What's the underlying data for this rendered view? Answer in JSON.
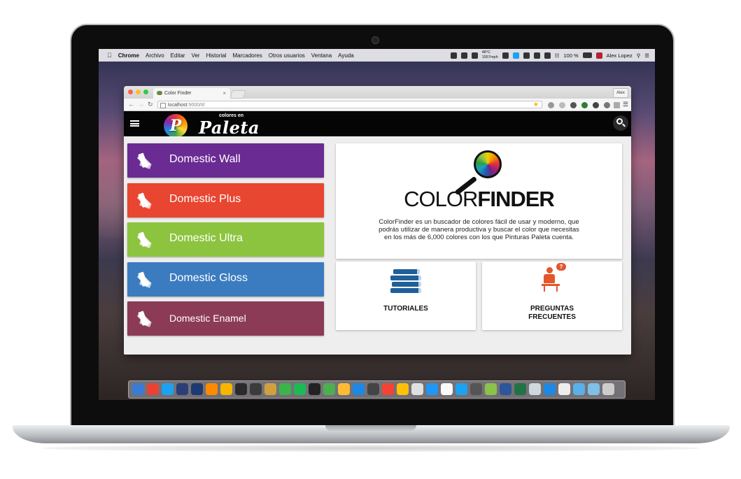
{
  "menubar": {
    "app": "Chrome",
    "items": [
      "Archivo",
      "Editar",
      "Ver",
      "Historial",
      "Marcadores",
      "Otros usuarios",
      "Ventana",
      "Ayuda"
    ],
    "weather_temp": "48°C",
    "weather_time": "1557mph",
    "battery": "100 %",
    "user": "Alex Lopez"
  },
  "browser": {
    "tab_title": "Color Finder",
    "profile": "Alex",
    "url_host": "localhost",
    "url_rest": ":9000/#/"
  },
  "app": {
    "logo_small": "colores en",
    "logo_letter": "P",
    "logo_name": "Paleta",
    "products": [
      {
        "label": "Domestic Wall",
        "color": "#6a2b93"
      },
      {
        "label": "Domestic Plus",
        "color": "#e84631"
      },
      {
        "label": "Domestic Ultra",
        "color": "#8cc43f"
      },
      {
        "label": "Domestic Gloss",
        "color": "#3b7cc0"
      },
      {
        "label": "Domestic Enamel",
        "color": "#8b3b56"
      }
    ],
    "colorfinder": {
      "title_light": "COLOR",
      "title_bold": "FINDER",
      "description": "ColorFinder es un buscador de colores fácil de usar y moderno, que podrás utilizar de manera productiva y buscar el color que necesitas en los más de 6,000 colores con los que Pinturas Paleta cuenta."
    },
    "tutoriales_label": "TUTORIALES",
    "preguntas_line1": "PREGUNTAS",
    "preguntas_line2": "FRECUENTES",
    "bubble_text": "?"
  },
  "dock_colors": [
    "#3a7bd5",
    "#e94235",
    "#1da1f2",
    "#2c3e75",
    "#1e3a70",
    "#ff8a00",
    "#f7b500",
    "#2a2a2a",
    "#3b3b3b",
    "#d0a040",
    "#3bb44a",
    "#1db954",
    "#222",
    "#4caf50",
    "#ffbb33",
    "#1e88e5",
    "#444",
    "#f44336",
    "#ffc107",
    "#e0e0e0",
    "#2196f3",
    "#fafafa",
    "#1da1f2",
    "#555",
    "#8bc34a",
    "#2b579a",
    "#217346",
    "#cfd8dc",
    "#1e88e5",
    "#eeeeee",
    "#5ab0e8",
    "#7fbfe8",
    "#cccccc"
  ]
}
